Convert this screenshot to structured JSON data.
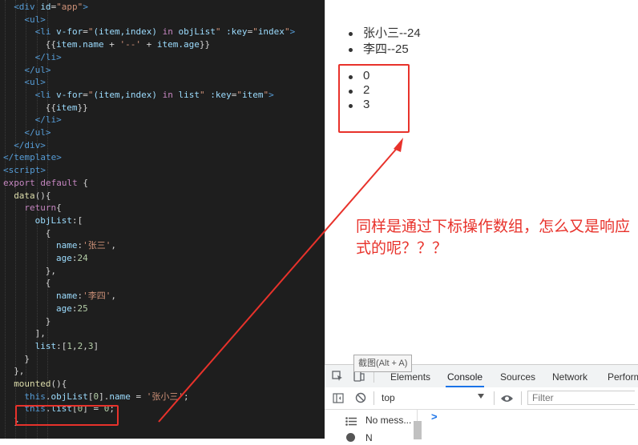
{
  "editor": {
    "lines": [
      {
        "i": 1,
        "html": "<span class=\"tag\">&lt;div</span> <span class=\"attr\">id</span>=<span class=\"str\">\"app\"</span><span class=\"tag\">&gt;</span>"
      },
      {
        "i": 2,
        "html": "<span class=\"tag\">&lt;ul&gt;</span>"
      },
      {
        "i": 3,
        "html": "<span class=\"tag\">&lt;li</span> <span class=\"attr\">v-for</span>=<span class=\"str\">\"</span><span class=\"prop\">(item,index)</span> <span class=\"kw\">in</span> <span class=\"prop\">objList</span><span class=\"str\">\"</span> <span class=\"attr\">:key</span>=<span class=\"str\">\"</span><span class=\"prop\">index</span><span class=\"str\">\"</span><span class=\"tag\">&gt;</span>"
      },
      {
        "i": 4,
        "html": "{{<span class=\"prop\">item.name</span> + <span class=\"str\">'--'</span> + <span class=\"prop\">item.age</span>}}"
      },
      {
        "i": 3,
        "html": "<span class=\"tag\">&lt;/li&gt;</span>"
      },
      {
        "i": 2,
        "html": "<span class=\"tag\">&lt;/ul&gt;</span>"
      },
      {
        "i": 2,
        "html": "<span class=\"tag\">&lt;ul&gt;</span>"
      },
      {
        "i": 3,
        "html": "<span class=\"tag\">&lt;li</span> <span class=\"attr\">v-for</span>=<span class=\"str\">\"</span><span class=\"prop\">(item,index)</span> <span class=\"kw\">in</span> <span class=\"prop\">list</span><span class=\"str\">\"</span> <span class=\"attr\">:key</span>=<span class=\"str\">\"</span><span class=\"prop\">item</span><span class=\"str\">\"</span><span class=\"tag\">&gt;</span>"
      },
      {
        "i": 4,
        "html": "{{<span class=\"prop\">item</span>}}"
      },
      {
        "i": 3,
        "html": "<span class=\"tag\">&lt;/li&gt;</span>"
      },
      {
        "i": 2,
        "html": "<span class=\"tag\">&lt;/ul&gt;</span>"
      },
      {
        "i": 1,
        "html": "<span class=\"tag\">&lt;/div&gt;</span>"
      },
      {
        "i": 0,
        "html": "<span class=\"tag\">&lt;/template&gt;</span>"
      },
      {
        "i": 0,
        "html": "<span class=\"tag\">&lt;script&gt;</span>"
      },
      {
        "i": 0,
        "html": "<span class=\"kw\">export</span> <span class=\"kw\">default</span> {"
      },
      {
        "i": 1,
        "html": "<span class=\"fn\">data</span>(){"
      },
      {
        "i": 2,
        "html": "<span class=\"kw\">return</span>{"
      },
      {
        "i": 3,
        "html": "<span class=\"prop\">objList</span>:["
      },
      {
        "i": 4,
        "html": "{"
      },
      {
        "i": 5,
        "html": "<span class=\"prop\">name</span>:<span class=\"str\">'张三'</span>,"
      },
      {
        "i": 5,
        "html": "<span class=\"prop\">age</span>:<span class=\"num\">24</span>"
      },
      {
        "i": 4,
        "html": "},"
      },
      {
        "i": 4,
        "html": "{"
      },
      {
        "i": 5,
        "html": "<span class=\"prop\">name</span>:<span class=\"str\">'李四'</span>,"
      },
      {
        "i": 5,
        "html": "<span class=\"prop\">age</span>:<span class=\"num\">25</span>"
      },
      {
        "i": 4,
        "html": "}"
      },
      {
        "i": 3,
        "html": "],"
      },
      {
        "i": 3,
        "html": "<span class=\"prop\">list</span>:[<span class=\"num\">1</span>,<span class=\"num\">2</span>,<span class=\"num\">3</span>]"
      },
      {
        "i": 2,
        "html": "}"
      },
      {
        "i": 1,
        "html": "},"
      },
      {
        "i": 1,
        "html": "<span class=\"fn\">mounted</span>(){"
      },
      {
        "i": 2,
        "html": "<span class=\"this\">this</span>.<span class=\"prop\">objList</span>[<span class=\"num\">0</span>].<span class=\"prop\">name</span> = <span class=\"str\">'张小三'</span>;"
      },
      {
        "i": 2,
        "html": "<span class=\"this\">this</span>.<span class=\"prop\">list</span>[<span class=\"num\">0</span>] = <span class=\"num\">0</span>;"
      },
      {
        "i": 1,
        "html": "}"
      }
    ]
  },
  "preview": {
    "obj_items": [
      "张小三--24",
      "李四--25"
    ],
    "list_items": [
      "0",
      "2",
      "3"
    ]
  },
  "annotation": "同样是通过下标操作数组，怎么又是响应式的呢？？？",
  "tooltip": "截图(Alt + A)",
  "devtools": {
    "tabs": [
      {
        "label": "Elements",
        "active": false
      },
      {
        "label": "Console",
        "active": true
      },
      {
        "label": "Sources",
        "active": false
      },
      {
        "label": "Network",
        "active": false
      },
      {
        "label": "Perform",
        "active": false
      }
    ],
    "context": "top",
    "filter_placeholder": "Filter",
    "sidebar_items": [
      "No mess...",
      "N"
    ],
    "prompt": ">"
  },
  "colors": {
    "annotation": "#e8322b",
    "editor_bg": "#1e1e1e",
    "accent": "#1a73e8"
  }
}
